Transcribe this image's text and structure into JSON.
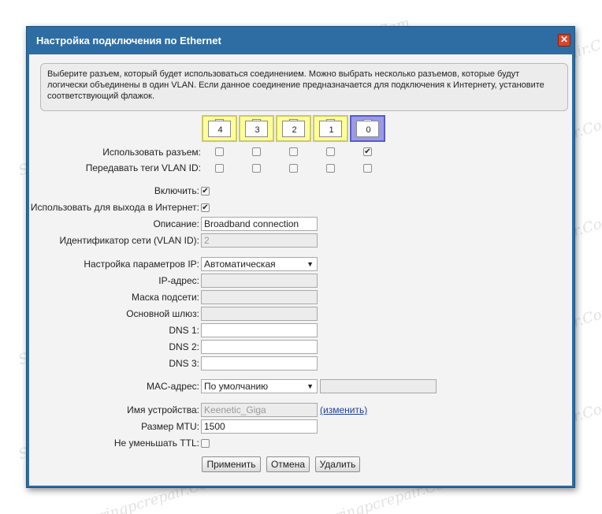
{
  "dialog": {
    "title": "Настройка подключения по Ethernet",
    "close_label": "✕",
    "info_text": "Выберите разъем, который будет использоваться соединением. Можно выбрать несколько разъемов, которые будут логически объединены в один VLAN. Если данное соединение предназначается для подключения к Интернету, установите соответствующий флажок."
  },
  "ports": {
    "labels": [
      "4",
      "3",
      "2",
      "1",
      "0"
    ],
    "active": "0",
    "use_label": "Использовать разъем:",
    "use_checked": [
      false,
      false,
      false,
      false,
      true
    ],
    "vlan_label": "Передавать теги VLAN ID:",
    "vlan_checked": [
      false,
      false,
      false,
      false,
      false
    ]
  },
  "form": {
    "enable_label": "Включить:",
    "enable_checked": true,
    "internet_label": "Использовать для выхода в Интернет:",
    "internet_checked": true,
    "description_label": "Описание:",
    "description_value": "Broadband connection",
    "vlan_id_label": "Идентификатор сети (VLAN ID):",
    "vlan_id_value": "2",
    "ip_mode_label": "Настройка параметров IP:",
    "ip_mode_value": "Автоматическая",
    "ip_label": "IP-адрес:",
    "mask_label": "Маска подсети:",
    "gateway_label": "Основной шлюз:",
    "dns1_label": "DNS 1:",
    "dns2_label": "DNS 2:",
    "dns3_label": "DNS 3:",
    "mac_label": "MAC-адрес:",
    "mac_mode_value": "По умолчанию",
    "hostname_label": "Имя устройства:",
    "hostname_value": "Keenetic_Giga",
    "hostname_change": "(изменить)",
    "mtu_label": "Размер MTU:",
    "mtu_value": "1500",
    "ttl_label": "Не уменьшать TTL:",
    "ttl_checked": false
  },
  "buttons": {
    "apply": "Применить",
    "cancel": "Отмена",
    "delete": "Удалить"
  },
  "watermark": "Soringpcrepair.Com"
}
